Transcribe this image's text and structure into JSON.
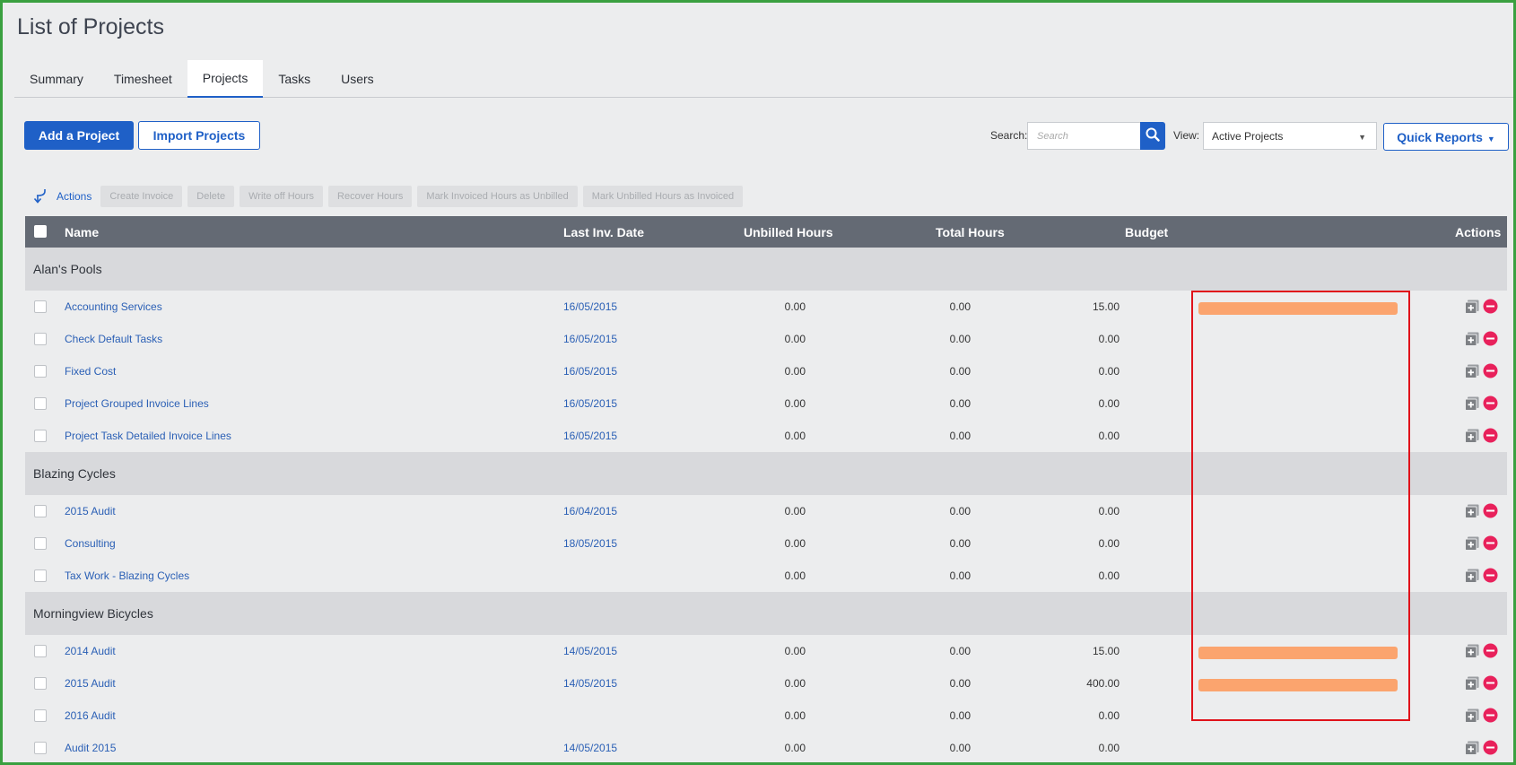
{
  "page": {
    "title": "List of Projects"
  },
  "tabs": [
    {
      "label": "Summary",
      "active": false
    },
    {
      "label": "Timesheet",
      "active": false
    },
    {
      "label": "Projects",
      "active": true
    },
    {
      "label": "Tasks",
      "active": false
    },
    {
      "label": "Users",
      "active": false
    }
  ],
  "toolbar": {
    "add_project": "Add a Project",
    "import_projects": "Import Projects",
    "search_label": "Search:",
    "search_placeholder": "Search",
    "view_label": "View:",
    "view_value": "Active Projects",
    "quick_reports": "Quick Reports"
  },
  "actions_bar": {
    "label": "Actions",
    "buttons": [
      "Create Invoice",
      "Delete",
      "Write off Hours",
      "Recover Hours",
      "Mark Invoiced Hours as Unbilled",
      "Mark Unbilled Hours as Invoiced"
    ]
  },
  "table": {
    "headers": {
      "name": "Name",
      "last_inv_date": "Last Inv. Date",
      "unbilled_hours": "Unbilled Hours",
      "total_hours": "Total Hours",
      "budget": "Budget",
      "actions": "Actions"
    },
    "groups": [
      {
        "name": "Alan's Pools",
        "rows": [
          {
            "name": "Accounting Services",
            "date": "16/05/2015",
            "unbilled": "0.00",
            "total": "0.00",
            "budget": "15.00",
            "budget_used": 1.0
          },
          {
            "name": "Check Default Tasks",
            "date": "16/05/2015",
            "unbilled": "0.00",
            "total": "0.00",
            "budget": "0.00",
            "budget_used": 0
          },
          {
            "name": "Fixed Cost",
            "date": "16/05/2015",
            "unbilled": "0.00",
            "total": "0.00",
            "budget": "0.00",
            "budget_used": 0
          },
          {
            "name": "Project Grouped Invoice Lines",
            "date": "16/05/2015",
            "unbilled": "0.00",
            "total": "0.00",
            "budget": "0.00",
            "budget_used": 0
          },
          {
            "name": "Project Task Detailed Invoice Lines",
            "date": "16/05/2015",
            "unbilled": "0.00",
            "total": "0.00",
            "budget": "0.00",
            "budget_used": 0
          }
        ]
      },
      {
        "name": "Blazing Cycles",
        "rows": [
          {
            "name": "2015 Audit",
            "date": "16/04/2015",
            "unbilled": "0.00",
            "total": "0.00",
            "budget": "0.00",
            "budget_used": 0
          },
          {
            "name": "Consulting",
            "date": "18/05/2015",
            "unbilled": "0.00",
            "total": "0.00",
            "budget": "0.00",
            "budget_used": 0
          },
          {
            "name": "Tax Work - Blazing Cycles",
            "date": "",
            "unbilled": "0.00",
            "total": "0.00",
            "budget": "0.00",
            "budget_used": 0
          }
        ]
      },
      {
        "name": "Morningview Bicycles",
        "rows": [
          {
            "name": "2014 Audit",
            "date": "14/05/2015",
            "unbilled": "0.00",
            "total": "0.00",
            "budget": "15.00",
            "budget_used": 1.0
          },
          {
            "name": "2015 Audit",
            "date": "14/05/2015",
            "unbilled": "0.00",
            "total": "0.00",
            "budget": "400.00",
            "budget_used": 1.0
          },
          {
            "name": "2016 Audit",
            "date": "",
            "unbilled": "0.00",
            "total": "0.00",
            "budget": "0.00",
            "budget_used": 0
          },
          {
            "name": "Audit 2015",
            "date": "14/05/2015",
            "unbilled": "0.00",
            "total": "0.00",
            "budget": "0.00",
            "budget_used": 0
          }
        ]
      }
    ]
  },
  "colors": {
    "accent": "#1f60c7",
    "budget_bar": "#fba46e",
    "remove": "#e8215b",
    "highlight": "#e0121a",
    "frame": "#3aa040"
  }
}
